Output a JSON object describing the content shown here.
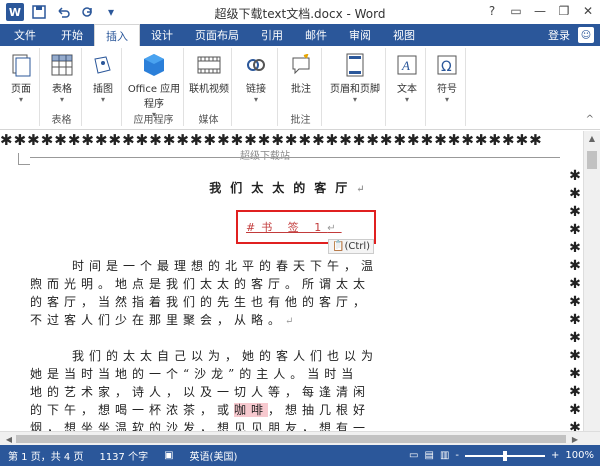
{
  "window": {
    "title": "超级下载text文档.docx - Word",
    "help": "?",
    "minimize": "—",
    "restore": "❐",
    "close": "✕"
  },
  "quick_access": {
    "logo": "W",
    "save_icon": "save-icon",
    "undo_icon": "undo-icon",
    "redo_icon": "redo-icon"
  },
  "tabs": [
    {
      "label": "文件"
    },
    {
      "label": "开始"
    },
    {
      "label": "插入"
    },
    {
      "label": "设计"
    },
    {
      "label": "页面布局"
    },
    {
      "label": "引用"
    },
    {
      "label": "邮件"
    },
    {
      "label": "审阅"
    },
    {
      "label": "视图"
    }
  ],
  "signin": "登录",
  "ribbon": {
    "groups": [
      {
        "name": "",
        "buttons": [
          {
            "label": "页面",
            "caret": "▾"
          }
        ]
      },
      {
        "name": "表格",
        "buttons": [
          {
            "label": "表格",
            "caret": "▾"
          }
        ]
      },
      {
        "name": "",
        "buttons": [
          {
            "label": "插图",
            "caret": "▾"
          }
        ]
      },
      {
        "name": "应用程序",
        "buttons": [
          {
            "label": "Office 应用程序",
            "caret": "▾"
          }
        ]
      },
      {
        "name": "媒体",
        "buttons": [
          {
            "label": "联机视频"
          }
        ]
      },
      {
        "name": "",
        "buttons": [
          {
            "label": "链接",
            "caret": "▾"
          }
        ]
      },
      {
        "name": "批注",
        "buttons": [
          {
            "label": "批注"
          }
        ]
      },
      {
        "name": "",
        "buttons": [
          {
            "label": "页眉和页脚",
            "caret": "▾"
          }
        ]
      },
      {
        "name": "",
        "buttons": [
          {
            "label": "文本",
            "caret": "▾"
          }
        ]
      },
      {
        "name": "",
        "buttons": [
          {
            "label": "符号",
            "caret": "▾"
          }
        ]
      }
    ],
    "collapse": "^"
  },
  "document": {
    "border_glyph": "✱",
    "header": "超级下载站",
    "title": "我们太太的客厅",
    "bookmark": "#书 签 1",
    "paste_options": "(Ctrl)",
    "paragraph1": [
      "时间是一个最理想的北平的春天下午，温",
      "煦而光明。地点是我们太太的客厅。所谓太太",
      "的客厅，当然指着我们的先生也有他的客厅，",
      "不过客人们少在那里聚会，从略。"
    ],
    "paragraph2": [
      "我们的太太自己以为，她的客人们也以为",
      "她是当时当地的一个“沙龙”的主人。当时当",
      "地的艺术家，诗人，以及一切人等，每逢清闲",
      "的下午，想喝一杯浓茶，或",
      "咖啡",
      "，想抽几根好",
      "烟，想坐坐温软的沙发，想见见朋友，想有一"
    ],
    "para_mark": "↵"
  },
  "statusbar": {
    "page": "第 1 页，共 4 页",
    "words": "1137 个字",
    "language": "英语(美国)",
    "zoom": "100%",
    "zoom_level": 0.5,
    "minus": "-",
    "plus": "+"
  }
}
